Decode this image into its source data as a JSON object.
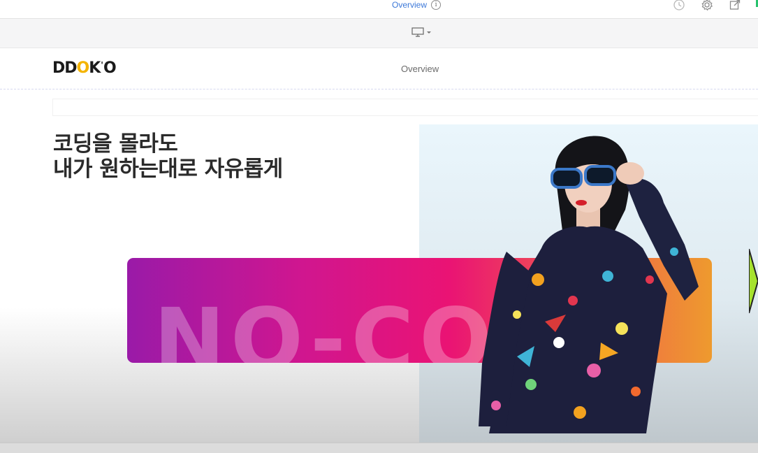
{
  "toolbar": {
    "page_tab_label": "Overview",
    "icons": [
      "history-icon",
      "gear-icon",
      "external-edit-icon"
    ]
  },
  "device_bar": {
    "device_icon": "desktop-icon"
  },
  "site": {
    "logo_text": "DDOK'O",
    "nav": [
      "Overview"
    ]
  },
  "hero": {
    "heading_line_1": "코딩을 몰라도",
    "heading_line_2": "내가 원하는대로 자유롭게",
    "banner_text": "NO-CODE",
    "colors": {
      "banner_start": "#9a1aa8",
      "banner_mid": "#ea1374",
      "banner_end": "#ee9a2e",
      "accent_arrow": "#a6e22e"
    }
  },
  "colors": {
    "link_blue": "#3c78d8",
    "logo_yellow": "#f4b400"
  }
}
